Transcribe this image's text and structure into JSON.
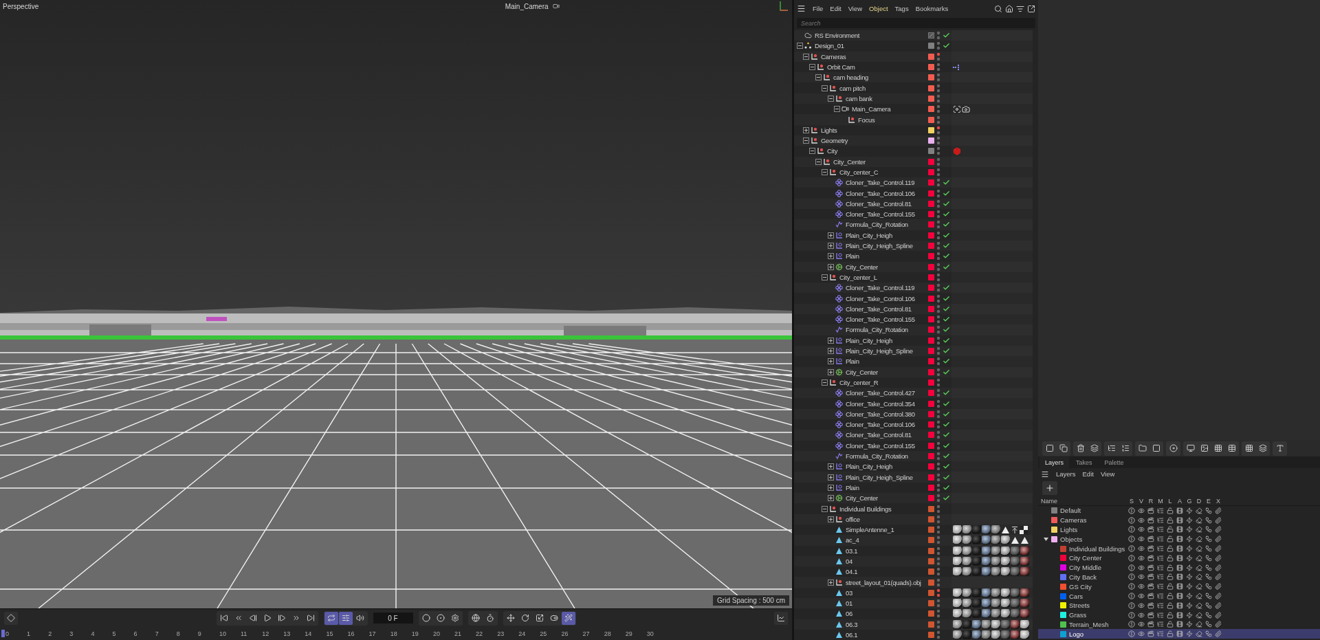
{
  "viewport": {
    "view_name": "Perspective",
    "camera": "Main_Camera",
    "grid_spacing": "Grid Spacing : 500 cm"
  },
  "timeline": {
    "frame": "0 F",
    "button_groups": [
      [
        {
          "kind": "first",
          "on": false
        },
        {
          "kind": "prev-key",
          "on": false
        },
        {
          "kind": "prev-frame",
          "on": false
        },
        {
          "kind": "play",
          "on": false
        },
        {
          "kind": "next-frame",
          "on": false
        },
        {
          "kind": "next-key",
          "on": false
        },
        {
          "kind": "last",
          "on": false
        }
      ],
      [
        {
          "kind": "loop",
          "on": true
        },
        {
          "kind": "range",
          "on": true
        },
        {
          "kind": "sound",
          "on": false
        }
      ],
      [
        {
          "kind": "record",
          "on": false
        },
        {
          "kind": "autokey",
          "on": false
        },
        {
          "kind": "gear",
          "on": false
        }
      ],
      [
        {
          "kind": "motion",
          "on": false
        },
        {
          "kind": "timer",
          "on": false
        }
      ],
      [
        {
          "kind": "move",
          "on": false
        },
        {
          "kind": "rotate",
          "on": false
        },
        {
          "kind": "scale",
          "on": false
        },
        {
          "kind": "param",
          "on": false
        },
        {
          "kind": "wand",
          "on": true
        }
      ]
    ],
    "ruler": [
      "0",
      "1",
      "2",
      "3",
      "4",
      "5",
      "6",
      "7",
      "8",
      "9",
      "10",
      "11",
      "12",
      "13",
      "14",
      "15",
      "16",
      "17",
      "18",
      "19",
      "20",
      "21",
      "22",
      "23",
      "24",
      "25",
      "26",
      "27",
      "28",
      "29",
      "30"
    ]
  },
  "object_manager": {
    "menu": [
      {
        "label": "File",
        "selected": false
      },
      {
        "label": "Edit",
        "selected": false
      },
      {
        "label": "View",
        "selected": false
      },
      {
        "label": "Object",
        "selected": true
      },
      {
        "label": "Tags",
        "selected": false
      },
      {
        "label": "Bookmarks",
        "selected": false
      }
    ],
    "search": {
      "placeholder": "Search"
    },
    "objects": [
      {
        "name": "RS Environment",
        "kind": "environment",
        "editor_visible": true,
        "render_visible": true,
        "checked": true
      },
      {
        "name": "Design_01",
        "kind": "connect",
        "color": "#808080",
        "editor_visible": true,
        "render_visible": true,
        "checked": true,
        "expanded": true,
        "children": [
          {
            "name": "Cameras",
            "kind": "null",
            "color": "#f25c50",
            "editor_visible": false,
            "render_visible": true,
            "checked": false,
            "expanded": true,
            "children": [
              {
                "name": "Orbit Cam",
                "kind": "null",
                "color": "#f25c50",
                "editor_visible": true,
                "render_visible": true,
                "checked": false,
                "expanded": true,
                "tags": [
                  {
                    "kind": "xpresso"
                  }
                ],
                "children": [
                  {
                    "name": "cam heading",
                    "kind": "null",
                    "color": "#f25c50",
                    "editor_visible": true,
                    "render_visible": true,
                    "checked": false,
                    "expanded": true,
                    "children": [
                      {
                        "name": "cam pitch",
                        "kind": "null",
                        "color": "#f25c50",
                        "editor_visible": true,
                        "render_visible": true,
                        "checked": false,
                        "expanded": true,
                        "children": [
                          {
                            "name": "cam bank",
                            "kind": "null",
                            "color": "#f25c50",
                            "editor_visible": true,
                            "render_visible": true,
                            "checked": false,
                            "expanded": true,
                            "children": [
                              {
                                "name": "Main_Camera",
                                "kind": "camera",
                                "color": "#f25c50",
                                "editor_visible": true,
                                "render_visible": true,
                                "checked": false,
                                "expanded": true,
                                "tags": [
                                  {
                                    "kind": "target"
                                  },
                                  {
                                    "kind": "camera"
                                  }
                                ],
                                "children": [
                                  {
                                    "name": "Focus",
                                    "kind": "null",
                                    "color": "#f25c50",
                                    "editor_visible": true,
                                    "render_visible": true,
                                    "checked": false
                                  }
                                ]
                              }
                            ]
                          }
                        ]
                      }
                    ]
                  }
                ]
              }
            ]
          },
          {
            "name": "Lights",
            "kind": "null",
            "color": "#f0d060",
            "editor_visible": false,
            "render_visible": true,
            "checked": false,
            "expanded": false
          },
          {
            "name": "Geometry",
            "kind": "null",
            "color": "#eab0f0",
            "editor_visible": true,
            "render_visible": true,
            "checked": false,
            "expanded": true,
            "children": [
              {
                "name": "City",
                "kind": "null",
                "color": "#808080",
                "editor_visible": true,
                "render_visible": true,
                "checked": false,
                "expanded": true,
                "tags": [
                  {
                    "kind": "cube"
                  }
                ],
                "children": [
                  {
                    "name": "City_Center",
                    "kind": "null",
                    "color": "#f5003c",
                    "editor_visible": true,
                    "render_visible": true,
                    "checked": false,
                    "expanded": true,
                    "children": [
                      {
                        "name": "City_center_C",
                        "kind": "null",
                        "color": "#f5003c",
                        "editor_visible": true,
                        "render_visible": true,
                        "checked": false,
                        "expanded": true,
                        "children": [
                          {
                            "name": "Cloner_Take_Control.119",
                            "kind": "cloner",
                            "color": "#f5003c",
                            "editor_visible": true,
                            "render_visible": true,
                            "checked": true
                          },
                          {
                            "name": "Cloner_Take_Control.106",
                            "kind": "cloner",
                            "color": "#f5003c",
                            "editor_visible": true,
                            "render_visible": true,
                            "checked": true
                          },
                          {
                            "name": "Cloner_Take_Control.81",
                            "kind": "cloner",
                            "color": "#f5003c",
                            "editor_visible": true,
                            "render_visible": true,
                            "checked": true
                          },
                          {
                            "name": "Cloner_Take_Control.155",
                            "kind": "cloner",
                            "color": "#f5003c",
                            "editor_visible": true,
                            "render_visible": true,
                            "checked": true
                          },
                          {
                            "name": "Formula_City_Rotation",
                            "kind": "formula",
                            "color": "#f5003c",
                            "editor_visible": true,
                            "render_visible": true,
                            "checked": true
                          },
                          {
                            "name": "Plain_City_Heigh",
                            "kind": "spline-null",
                            "color": "#f5003c",
                            "editor_visible": true,
                            "render_visible": true,
                            "checked": true,
                            "expanded": false
                          },
                          {
                            "name": "Plain_City_Heigh_Spline",
                            "kind": "spline-null",
                            "color": "#f5003c",
                            "editor_visible": true,
                            "render_visible": true,
                            "checked": true,
                            "expanded": false
                          },
                          {
                            "name": "Plain",
                            "kind": "spline-null",
                            "color": "#f5003c",
                            "editor_visible": true,
                            "render_visible": true,
                            "checked": true,
                            "expanded": false
                          },
                          {
                            "name": "City_Center",
                            "kind": "effector",
                            "color": "#f5003c",
                            "editor_visible": true,
                            "render_visible": true,
                            "checked": true,
                            "expanded": false
                          }
                        ]
                      },
                      {
                        "name": "City_center_L",
                        "kind": "null",
                        "color": "#f5003c",
                        "editor_visible": true,
                        "render_visible": true,
                        "checked": false,
                        "expanded": true,
                        "children": [
                          {
                            "name": "Cloner_Take_Control.119",
                            "kind": "cloner",
                            "color": "#f5003c",
                            "editor_visible": true,
                            "render_visible": true,
                            "checked": true
                          },
                          {
                            "name": "Cloner_Take_Control.106",
                            "kind": "cloner",
                            "color": "#f5003c",
                            "editor_visible": true,
                            "render_visible": true,
                            "checked": true
                          },
                          {
                            "name": "Cloner_Take_Control.81",
                            "kind": "cloner",
                            "color": "#f5003c",
                            "editor_visible": true,
                            "render_visible": true,
                            "checked": true
                          },
                          {
                            "name": "Cloner_Take_Control.155",
                            "kind": "cloner",
                            "color": "#f5003c",
                            "editor_visible": true,
                            "render_visible": true,
                            "checked": true
                          },
                          {
                            "name": "Formula_City_Rotation",
                            "kind": "formula",
                            "color": "#f5003c",
                            "editor_visible": true,
                            "render_visible": true,
                            "checked": true
                          },
                          {
                            "name": "Plain_City_Heigh",
                            "kind": "spline-null",
                            "color": "#f5003c",
                            "editor_visible": true,
                            "render_visible": true,
                            "checked": true,
                            "expanded": false
                          },
                          {
                            "name": "Plain_City_Heigh_Spline",
                            "kind": "spline-null",
                            "color": "#f5003c",
                            "editor_visible": true,
                            "render_visible": true,
                            "checked": true,
                            "expanded": false
                          },
                          {
                            "name": "Plain",
                            "kind": "spline-null",
                            "color": "#f5003c",
                            "editor_visible": true,
                            "render_visible": true,
                            "checked": true,
                            "expanded": false
                          },
                          {
                            "name": "City_Center",
                            "kind": "effector",
                            "color": "#f5003c",
                            "editor_visible": true,
                            "render_visible": true,
                            "checked": true,
                            "expanded": false
                          }
                        ]
                      },
                      {
                        "name": "City_center_R",
                        "kind": "null",
                        "color": "#f5003c",
                        "editor_visible": true,
                        "render_visible": true,
                        "checked": false,
                        "expanded": true,
                        "children": [
                          {
                            "name": "Cloner_Take_Control.427",
                            "kind": "cloner",
                            "color": "#f5003c",
                            "editor_visible": true,
                            "render_visible": true,
                            "checked": true
                          },
                          {
                            "name": "Cloner_Take_Control.354",
                            "kind": "cloner",
                            "color": "#f5003c",
                            "editor_visible": true,
                            "render_visible": true,
                            "checked": true
                          },
                          {
                            "name": "Cloner_Take_Control.380",
                            "kind": "cloner",
                            "color": "#f5003c",
                            "editor_visible": true,
                            "render_visible": true,
                            "checked": true
                          },
                          {
                            "name": "Cloner_Take_Control.106",
                            "kind": "cloner",
                            "color": "#f5003c",
                            "editor_visible": true,
                            "render_visible": true,
                            "checked": true
                          },
                          {
                            "name": "Cloner_Take_Control.81",
                            "kind": "cloner",
                            "color": "#f5003c",
                            "editor_visible": true,
                            "render_visible": true,
                            "checked": true
                          },
                          {
                            "name": "Cloner_Take_Control.155",
                            "kind": "cloner",
                            "color": "#f5003c",
                            "editor_visible": true,
                            "render_visible": true,
                            "checked": true
                          },
                          {
                            "name": "Formula_City_Rotation",
                            "kind": "formula",
                            "color": "#f5003c",
                            "editor_visible": true,
                            "render_visible": true,
                            "checked": true
                          },
                          {
                            "name": "Plain_City_Heigh",
                            "kind": "spline-null",
                            "color": "#f5003c",
                            "editor_visible": true,
                            "render_visible": true,
                            "checked": true,
                            "expanded": false
                          },
                          {
                            "name": "Plain_City_Heigh_Spline",
                            "kind": "spline-null",
                            "color": "#f5003c",
                            "editor_visible": true,
                            "render_visible": true,
                            "checked": true,
                            "expanded": false
                          },
                          {
                            "name": "Plain",
                            "kind": "spline-null",
                            "color": "#f5003c",
                            "editor_visible": true,
                            "render_visible": true,
                            "checked": true,
                            "expanded": false
                          },
                          {
                            "name": "City_Center",
                            "kind": "effector",
                            "color": "#f5003c",
                            "editor_visible": true,
                            "render_visible": true,
                            "checked": true,
                            "expanded": false
                          }
                        ]
                      },
                      {
                        "name": "Individual Buildings",
                        "kind": "null",
                        "color": "#d05530",
                        "editor_visible": true,
                        "render_visible": true,
                        "checked": false,
                        "expanded": true,
                        "children": [
                          {
                            "name": "office",
                            "kind": "null",
                            "color": "#d05530",
                            "editor_visible": true,
                            "render_visible": true,
                            "checked": false,
                            "expanded": false
                          },
                          {
                            "name": "SimpleAntenne_1",
                            "kind": "polygon",
                            "color": "#d05530",
                            "editor_visible": true,
                            "render_visible": true,
                            "checked": false,
                            "tags": [
                              {
                                "kind": "material"
                              },
                              {
                                "kind": "material"
                              },
                              {
                                "kind": "material"
                              },
                              {
                                "kind": "material"
                              },
                              {
                                "kind": "material"
                              },
                              {
                                "kind": "triangle"
                              },
                              {
                                "kind": "restrict"
                              },
                              {
                                "kind": "checker"
                              }
                            ]
                          },
                          {
                            "name": "ac_4",
                            "kind": "polygon",
                            "color": "#d05530",
                            "editor_visible": true,
                            "render_visible": true,
                            "checked": false,
                            "tags": [
                              {
                                "kind": "material"
                              },
                              {
                                "kind": "material"
                              },
                              {
                                "kind": "material"
                              },
                              {
                                "kind": "material"
                              },
                              {
                                "kind": "material"
                              },
                              {
                                "kind": "material"
                              },
                              {
                                "kind": "triangle"
                              },
                              {
                                "kind": "triangle"
                              }
                            ]
                          },
                          {
                            "name": "03.1",
                            "kind": "polygon",
                            "color": "#d05530",
                            "editor_visible": true,
                            "render_visible": true,
                            "checked": false,
                            "tags": [
                              {
                                "kind": "material"
                              },
                              {
                                "kind": "material"
                              },
                              {
                                "kind": "material"
                              },
                              {
                                "kind": "material"
                              },
                              {
                                "kind": "material"
                              },
                              {
                                "kind": "material"
                              },
                              {
                                "kind": "material"
                              },
                              {
                                "kind": "material"
                              }
                            ]
                          },
                          {
                            "name": "04",
                            "kind": "polygon",
                            "color": "#d05530",
                            "editor_visible": true,
                            "render_visible": true,
                            "checked": false,
                            "tags": [
                              {
                                "kind": "material"
                              },
                              {
                                "kind": "material"
                              },
                              {
                                "kind": "material"
                              },
                              {
                                "kind": "material"
                              },
                              {
                                "kind": "material"
                              },
                              {
                                "kind": "material"
                              },
                              {
                                "kind": "material"
                              },
                              {
                                "kind": "material"
                              }
                            ]
                          },
                          {
                            "name": "04.1",
                            "kind": "polygon",
                            "color": "#d05530",
                            "editor_visible": true,
                            "render_visible": true,
                            "checked": false,
                            "tags": [
                              {
                                "kind": "material"
                              },
                              {
                                "kind": "material"
                              },
                              {
                                "kind": "material"
                              },
                              {
                                "kind": "material"
                              },
                              {
                                "kind": "material"
                              },
                              {
                                "kind": "material"
                              },
                              {
                                "kind": "material"
                              },
                              {
                                "kind": "material"
                              }
                            ]
                          },
                          {
                            "name": "street_layout_01(quads).obj",
                            "kind": "null",
                            "color": "#d05530",
                            "editor_visible": true,
                            "render_visible": true,
                            "checked": false,
                            "expanded": false
                          },
                          {
                            "name": "03",
                            "kind": "polygon",
                            "color": "#d05530",
                            "editor_visible": false,
                            "render_visible": false,
                            "checked": false,
                            "tags": [
                              {
                                "kind": "material"
                              },
                              {
                                "kind": "material"
                              },
                              {
                                "kind": "material"
                              },
                              {
                                "kind": "material"
                              },
                              {
                                "kind": "material"
                              },
                              {
                                "kind": "material"
                              },
                              {
                                "kind": "material"
                              },
                              {
                                "kind": "material"
                              }
                            ]
                          },
                          {
                            "name": "01",
                            "kind": "polygon",
                            "color": "#d05530",
                            "editor_visible": true,
                            "render_visible": true,
                            "checked": false,
                            "tags": [
                              {
                                "kind": "material"
                              },
                              {
                                "kind": "material"
                              },
                              {
                                "kind": "material"
                              },
                              {
                                "kind": "material"
                              },
                              {
                                "kind": "material"
                              },
                              {
                                "kind": "material"
                              },
                              {
                                "kind": "material"
                              },
                              {
                                "kind": "material"
                              }
                            ]
                          },
                          {
                            "name": "06",
                            "kind": "polygon",
                            "color": "#d05530",
                            "editor_visible": true,
                            "render_visible": true,
                            "checked": false,
                            "tags": [
                              {
                                "kind": "material"
                              },
                              {
                                "kind": "material"
                              },
                              {
                                "kind": "material"
                              },
                              {
                                "kind": "material"
                              },
                              {
                                "kind": "material"
                              },
                              {
                                "kind": "material"
                              },
                              {
                                "kind": "material"
                              },
                              {
                                "kind": "material"
                              }
                            ]
                          },
                          {
                            "name": "06.3",
                            "kind": "polygon",
                            "color": "#d05530",
                            "editor_visible": true,
                            "render_visible": true,
                            "checked": false,
                            "tags": [
                              {
                                "kind": "material"
                              },
                              {
                                "kind": "material"
                              },
                              {
                                "kind": "material"
                              },
                              {
                                "kind": "material"
                              },
                              {
                                "kind": "material"
                              },
                              {
                                "kind": "material"
                              },
                              {
                                "kind": "material"
                              },
                              {
                                "kind": "material"
                              }
                            ]
                          },
                          {
                            "name": "06.1",
                            "kind": "polygon",
                            "color": "#d05530",
                            "editor_visible": true,
                            "render_visible": true,
                            "checked": false,
                            "tags": [
                              {
                                "kind": "material"
                              },
                              {
                                "kind": "material"
                              },
                              {
                                "kind": "material"
                              },
                              {
                                "kind": "material"
                              },
                              {
                                "kind": "material"
                              },
                              {
                                "kind": "material"
                              },
                              {
                                "kind": "material"
                              },
                              {
                                "kind": "material"
                              }
                            ]
                          }
                        ]
                      }
                    ]
                  }
                ]
              }
            ]
          }
        ]
      }
    ]
  },
  "layer_manager": {
    "tabs": [
      {
        "label": "Layers",
        "selected": true
      },
      {
        "label": "Takes",
        "selected": false
      },
      {
        "label": "Palette",
        "selected": false
      }
    ],
    "menu": [
      "Layers",
      "Edit",
      "View"
    ],
    "columns": [
      "Name",
      "S",
      "V",
      "R",
      "M",
      "L",
      "A",
      "G",
      "D",
      "E",
      "X"
    ],
    "layers": [
      {
        "name": "Default",
        "color": "#808080",
        "selected": false
      },
      {
        "name": "Cameras",
        "color": "#f05a5a",
        "selected": false
      },
      {
        "name": "Lights",
        "color": "#f0d060",
        "selected": false
      },
      {
        "name": "Objects",
        "color": "#f0b0f0",
        "selected": false,
        "expanded": true,
        "children": [
          {
            "name": "Individual Buildings",
            "color": "#c04030",
            "selected": false
          },
          {
            "name": "City Center",
            "color": "#f0003c",
            "selected": false
          },
          {
            "name": "City Middle",
            "color": "#e000e0",
            "selected": false
          },
          {
            "name": "City Back",
            "color": "#6070f0",
            "selected": false
          },
          {
            "name": "GS City",
            "color": "#f05030",
            "selected": false
          },
          {
            "name": "Cars",
            "color": "#0060f0",
            "selected": false
          },
          {
            "name": "Streets",
            "color": "#f0f000",
            "selected": false
          },
          {
            "name": "Grass",
            "color": "#20f0e0",
            "selected": false
          },
          {
            "name": "Terrain_Mesh",
            "color": "#50c050",
            "selected": false
          },
          {
            "name": "Logo",
            "color": "#10a0d0",
            "selected": true
          }
        ]
      }
    ]
  }
}
